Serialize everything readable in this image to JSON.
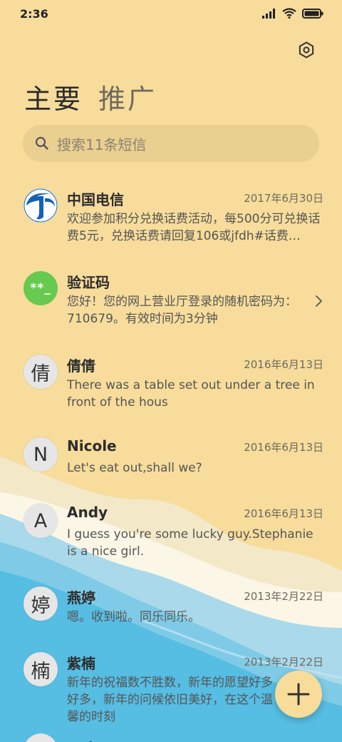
{
  "status_bar": {
    "time": "2:36"
  },
  "tabs": [
    {
      "label": "主要"
    },
    {
      "label": "推广"
    }
  ],
  "search": {
    "placeholder": "搜索11条短信"
  },
  "threads": [
    {
      "name": "中国电信",
      "date": "2017年6月30日",
      "preview": "欢迎参加积分兑换话费活动，每500分可兑换话费5元，兑换话费请回复106或jfdh#话费…",
      "avatar": "telecom-logo"
    },
    {
      "name": "验证码",
      "date": "",
      "preview": "您好！您的网上营业厅登录的随机密码为：710679。有效时间为3分钟",
      "avatar_text": "**_"
    },
    {
      "name": "倩倩",
      "date": "2016年6月13日",
      "preview": "There was a table set out under a tree in front of the hous",
      "avatar_text": "倩"
    },
    {
      "name": "Nicole",
      "date": "2016年6月13日",
      "preview": "Let's eat out,shall we?",
      "avatar_text": "N"
    },
    {
      "name": "Andy",
      "date": "2016年6月13日",
      "preview": "I guess you're some lucky guy.Stephanie is a nice girl.",
      "avatar_text": "A"
    },
    {
      "name": "燕婷",
      "date": "2013年2月22日",
      "preview": "嗯。收到啦。同乐同乐。",
      "avatar_text": "婷"
    },
    {
      "name": "紫楠",
      "date": "2013年2月22日",
      "preview": "新年的祝福数不胜数，新年的愿望好多好多，新年的问候依旧美好，在这个温馨的时刻",
      "avatar_text": "楠"
    },
    {
      "name": "子玲",
      "date": "",
      "preview": "",
      "avatar_text": ""
    }
  ],
  "colors": {
    "background": "#f7dc9b",
    "sea_light": "#a9d9eb",
    "sea_deep": "#56bde3",
    "verify_green": "#68c94f",
    "telecom_blue": "#1461b5"
  }
}
